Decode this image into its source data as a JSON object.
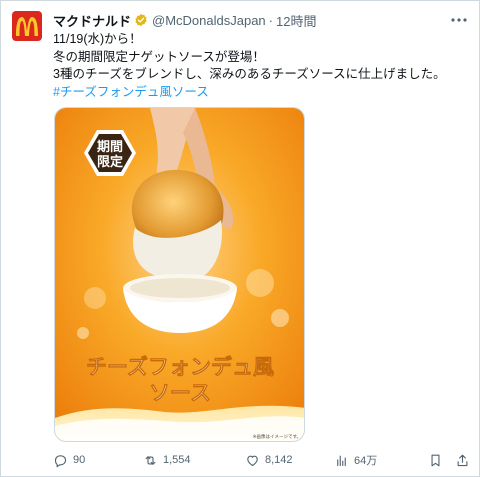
{
  "tweet": {
    "author": {
      "name": "マクドナルド",
      "handle": "@McDonaldsJapan",
      "time": "12時間"
    },
    "text_lines": [
      "11/19(水)から！",
      "冬の期間限定ナゲットソースが登場！",
      "3種のチーズをブレンドし、深みのあるチーズソースに仕上げました。"
    ],
    "hashtag": "#チーズフォンデュ風ソース",
    "media": {
      "badge_line1": "期間",
      "badge_line2": "限定",
      "title_line1": "チーズフォンデュ風",
      "title_line2": "ソース",
      "note": "※画像はイメージです。"
    },
    "stats": {
      "replies": "90",
      "retweets": "1,554",
      "likes": "8,142",
      "views": "64万"
    }
  },
  "colors": {
    "brand_red": "#da291c",
    "brand_yellow": "#ffc72c",
    "link_blue": "#1d9bf0",
    "verified_gold": "#e2b719"
  }
}
